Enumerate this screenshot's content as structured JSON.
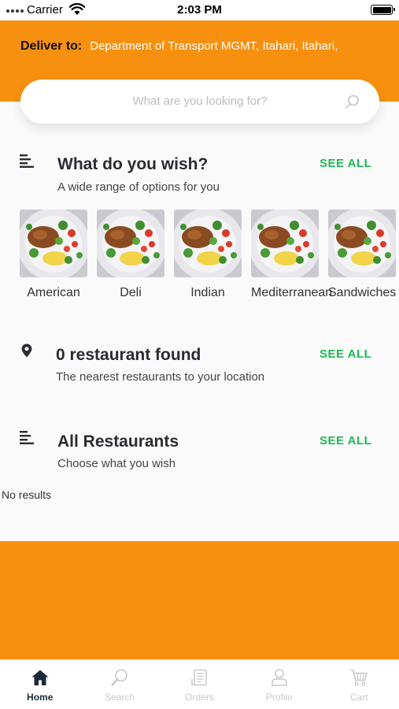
{
  "status_bar": {
    "carrier": "Carrier",
    "time": "2:03 PM"
  },
  "header": {
    "deliver_label": "Deliver to:",
    "address": "Department of Transport MGMT, Itahari, Itahari,"
  },
  "search": {
    "placeholder": "What are you looking for?"
  },
  "wish_section": {
    "title": "What do you wish?",
    "subtitle": "A wide range of options for you",
    "see_all": "SEE ALL",
    "categories": [
      {
        "name": "American"
      },
      {
        "name": "Deli"
      },
      {
        "name": "Indian"
      },
      {
        "name": "Mediterranean"
      },
      {
        "name": "Sandwiches"
      }
    ]
  },
  "nearby_section": {
    "title": "0 restaurant found",
    "subtitle": "The nearest restaurants to your location",
    "see_all": "SEE ALL"
  },
  "all_section": {
    "title": "All Restaurants",
    "subtitle": "Choose what you wish",
    "see_all": "SEE ALL",
    "empty_text": "No results"
  },
  "tabs": [
    {
      "label": "Home",
      "icon": "home-icon",
      "active": true
    },
    {
      "label": "Search",
      "icon": "search-icon",
      "active": false
    },
    {
      "label": "Orders",
      "icon": "receipt-icon",
      "active": false
    },
    {
      "label": "Profile",
      "icon": "user-icon",
      "active": false
    },
    {
      "label": "Cart",
      "icon": "cart-icon",
      "active": false
    }
  ],
  "colors": {
    "accent": "#f7900f",
    "link": "#1db954",
    "text_dark": "#2b2b33"
  }
}
